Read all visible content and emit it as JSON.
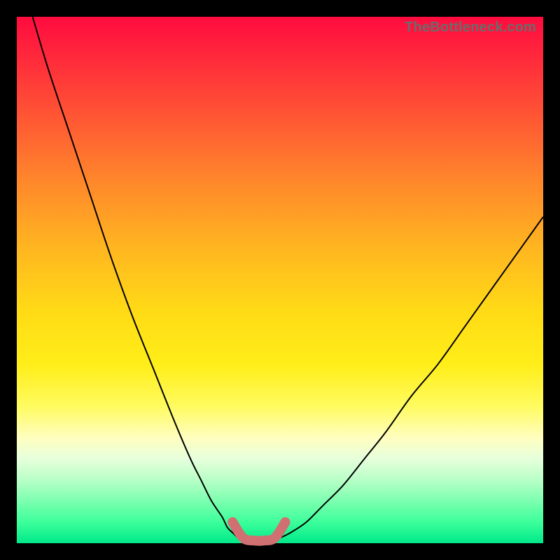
{
  "watermark": "TheBottleneck.com",
  "colors": {
    "curve": "#000000",
    "nub": "#d17072",
    "frame": "#000000"
  },
  "chart_data": {
    "type": "line",
    "title": "",
    "xlabel": "",
    "ylabel": "",
    "xlim": [
      0,
      100
    ],
    "ylim": [
      0,
      100
    ],
    "grid": false,
    "series": [
      {
        "name": "left-curve",
        "x": [
          3,
          6,
          10,
          14,
          18,
          22,
          26,
          30,
          33,
          35,
          37,
          39,
          40,
          41,
          42
        ],
        "y": [
          100,
          90,
          78,
          66,
          54,
          43,
          33,
          23,
          16,
          12,
          8,
          5,
          3,
          2,
          1
        ]
      },
      {
        "name": "right-curve",
        "x": [
          50,
          52,
          55,
          58,
          62,
          66,
          70,
          75,
          80,
          85,
          90,
          95,
          100
        ],
        "y": [
          1,
          2,
          4,
          7,
          11,
          16,
          21,
          28,
          34,
          41,
          48,
          55,
          62
        ]
      },
      {
        "name": "bottom-nub",
        "x": [
          41,
          43,
          45,
          47,
          49,
          51
        ],
        "y": [
          4,
          1,
          0.5,
          0.5,
          1,
          4
        ]
      }
    ],
    "annotations": [
      {
        "text": "TheBottleneck.com",
        "position": "top-right"
      }
    ]
  }
}
